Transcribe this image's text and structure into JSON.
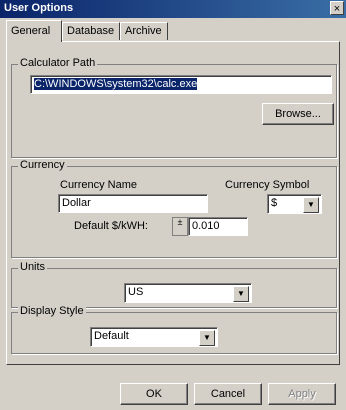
{
  "window": {
    "title": "User Options",
    "close_glyph": "×"
  },
  "tabs": [
    {
      "label": "General",
      "active": true
    },
    {
      "label": "Database",
      "active": false
    },
    {
      "label": "Archive",
      "active": false
    }
  ],
  "calculator": {
    "group_label": "Calculator Path",
    "path_value": "C:\\WINDOWS\\system32\\calc.exe",
    "browse_label": "Browse..."
  },
  "currency": {
    "group_label": "Currency",
    "name_label": "Currency Name",
    "name_value": "Dollar",
    "symbol_label": "Currency Symbol",
    "symbol_value": "$",
    "rate_label": "Default $/kWH:",
    "rate_value": "0.010"
  },
  "units": {
    "group_label": "Units",
    "value": "US"
  },
  "display_style": {
    "group_label": "Display Style",
    "value": "Default"
  },
  "buttons": {
    "ok": "OK",
    "cancel": "Cancel",
    "apply": "Apply"
  },
  "icons": {
    "dropdown": "chevron-down-icon",
    "spin": "spin-updown-icon",
    "close": "close-icon"
  }
}
